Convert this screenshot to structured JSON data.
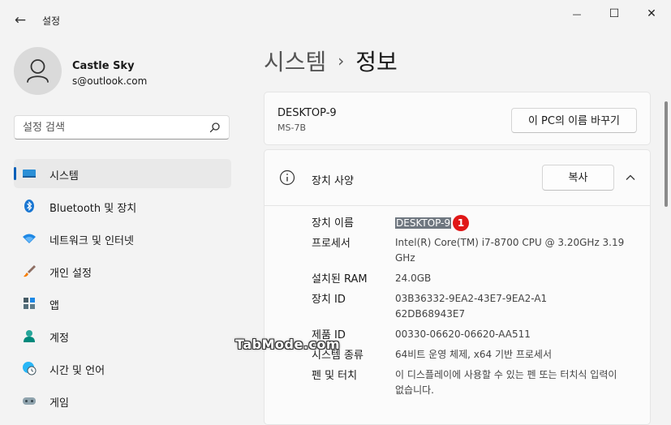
{
  "window": {
    "title": "설정",
    "back_glyph": "←",
    "minimize_glyph": "—",
    "maximize_glyph": "☐",
    "close_glyph": "✕"
  },
  "profile": {
    "name": "Castle Sky",
    "email": "s@outlook.com"
  },
  "search": {
    "placeholder": "설정 검색"
  },
  "sidebar": {
    "items": [
      {
        "label": "시스템",
        "icon": "monitor-icon",
        "active": true
      },
      {
        "label": "Bluetooth 및 장치",
        "icon": "bluetooth-icon"
      },
      {
        "label": "네트워크 및 인터넷",
        "icon": "wifi-icon"
      },
      {
        "label": "개인 설정",
        "icon": "brush-icon"
      },
      {
        "label": "앱",
        "icon": "apps-icon"
      },
      {
        "label": "계정",
        "icon": "person-icon"
      },
      {
        "label": "시간 및 언어",
        "icon": "globe-clock-icon"
      },
      {
        "label": "게임",
        "icon": "gamepad-icon"
      }
    ]
  },
  "breadcrumb": {
    "parent": "시스템",
    "separator": "›",
    "current": "정보"
  },
  "device": {
    "name": "DESKTOP-9",
    "model": "MS-7B",
    "rename_label": "이 PC의 이름 바꾸기"
  },
  "specs": {
    "title": "장치 사양",
    "copy_label": "복사",
    "marker": "1",
    "rows": [
      {
        "label": "장치 이름",
        "value": "DESKTOP-9"
      },
      {
        "label": "프로세서",
        "value": "Intel(R) Core(TM) i7-8700 CPU @ 3.20GHz 3.19 GHz"
      },
      {
        "label": "설치된 RAM",
        "value": "24.0GB"
      },
      {
        "label": "장치 ID",
        "value": "03B36332-9EA2-43E7-9EA2-A162DB68943E7"
      },
      {
        "label": "제품 ID",
        "value": "00330-06620-06620-AA511"
      },
      {
        "label": "시스템 종류",
        "value": "64비트 운영 체제, x64 기반 프로세서"
      },
      {
        "label": "펜 및 터치",
        "value": "이 디스플레이에 사용할 수 있는 펜 또는 터치식 입력이 없습니다."
      }
    ]
  },
  "watermark": "TabMode.com",
  "colors": {
    "accent": "#005fb8",
    "marker": "#e01717",
    "highlight": "#6f7780"
  }
}
